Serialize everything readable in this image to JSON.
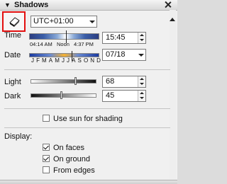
{
  "panel": {
    "title": "Shadows",
    "collapse_icon": "triangle-down-icon",
    "close_icon": "close-icon"
  },
  "toolbar": {
    "shadow_toggle_icon": "shadow-box-icon",
    "timezone": "UTC+01:00"
  },
  "time": {
    "label": "Time",
    "value": "15:45",
    "ticks": [
      "04:14 AM",
      "Noon",
      "4:37 PM"
    ],
    "slider_fraction": 0.52
  },
  "date": {
    "label": "Date",
    "value": "07/18",
    "months": [
      "J",
      "F",
      "M",
      "A",
      "M",
      "J",
      "J",
      "A",
      "S",
      "O",
      "N",
      "D"
    ],
    "slider_fraction": 0.6
  },
  "light": {
    "label": "Light",
    "value": "68"
  },
  "dark": {
    "label": "Dark",
    "value": "45"
  },
  "use_sun": {
    "label": "Use sun for shading",
    "checked": false
  },
  "display": {
    "heading": "Display:",
    "options": [
      {
        "label": "On faces",
        "checked": true
      },
      {
        "label": "On ground",
        "checked": true
      },
      {
        "label": "From edges",
        "checked": false
      }
    ]
  },
  "colors": {
    "highlight": "#e31010"
  }
}
